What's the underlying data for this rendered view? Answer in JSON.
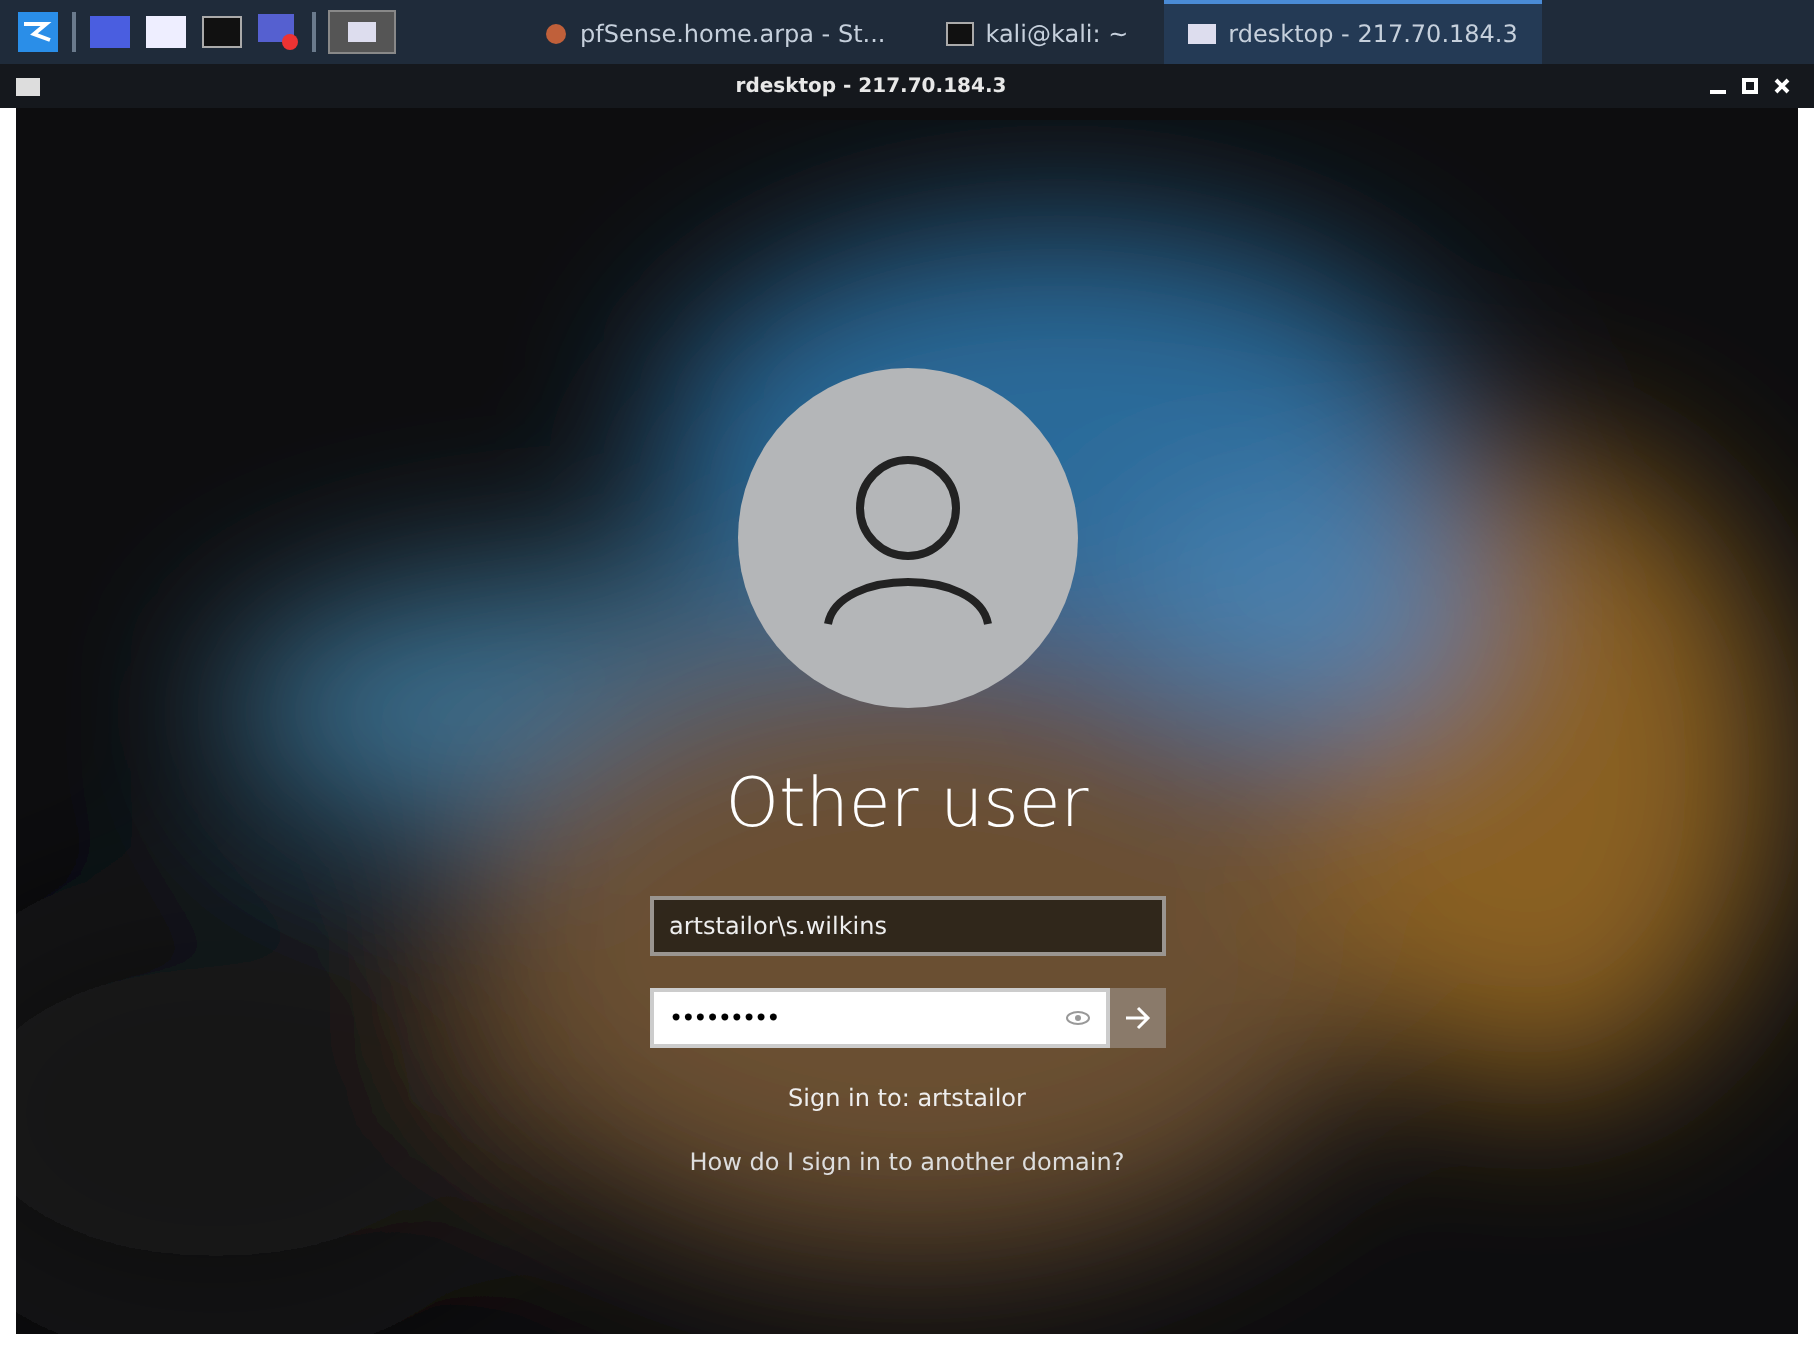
{
  "taskbar": {
    "tasks": [
      {
        "label": "pfSense.home.arpa - St...",
        "kind": "browser",
        "selected": false
      },
      {
        "label": "kali@kali: ~",
        "kind": "terminal",
        "selected": false
      },
      {
        "label": "rdesktop - 217.70.184.3",
        "kind": "window",
        "selected": true
      }
    ]
  },
  "window": {
    "title": "rdesktop - 217.70.184.3"
  },
  "login": {
    "user_name": "Other user",
    "username_value": "artstailor\\s.wilkins",
    "password_value": "•••••••••",
    "sign_in_to": "Sign in to: artstailor",
    "domain_link": "How do I sign in to another domain?"
  }
}
